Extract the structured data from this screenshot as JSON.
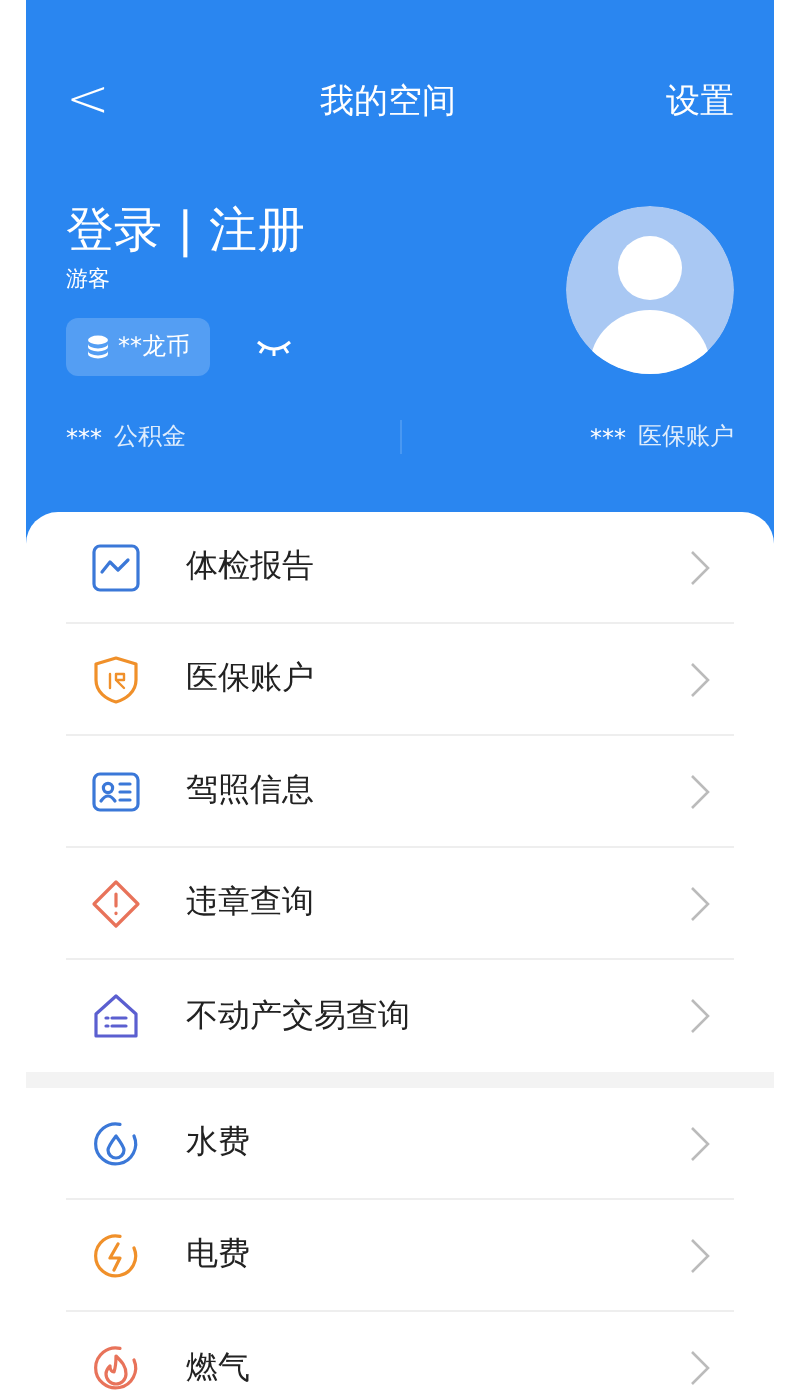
{
  "nav": {
    "back": "<",
    "title": "我的空间",
    "action": "设置"
  },
  "profile": {
    "name": "登录 | 注册",
    "role": "游客",
    "coins": "**龙币"
  },
  "balances": [
    {
      "value": "***",
      "label": "公积金"
    },
    {
      "value": "***",
      "label": "医保账户"
    }
  ],
  "sections": [
    {
      "items": [
        {
          "kind": "chart",
          "color": "#3b78d8",
          "label": "体检报告"
        },
        {
          "kind": "shield",
          "color": "#f0902a",
          "label": "医保账户"
        },
        {
          "kind": "card",
          "color": "#3b78d8",
          "label": "驾照信息"
        },
        {
          "kind": "warning",
          "color": "#e8735a",
          "label": "违章查询"
        },
        {
          "kind": "house",
          "color": "#5b5fd0",
          "label": "不动产交易查询"
        }
      ]
    },
    {
      "items": [
        {
          "kind": "drop",
          "color": "#3b78d8",
          "label": "水费"
        },
        {
          "kind": "bolt",
          "color": "#f0902a",
          "label": "电费"
        },
        {
          "kind": "flame",
          "color": "#e8735a",
          "label": "燃气"
        }
      ]
    }
  ]
}
